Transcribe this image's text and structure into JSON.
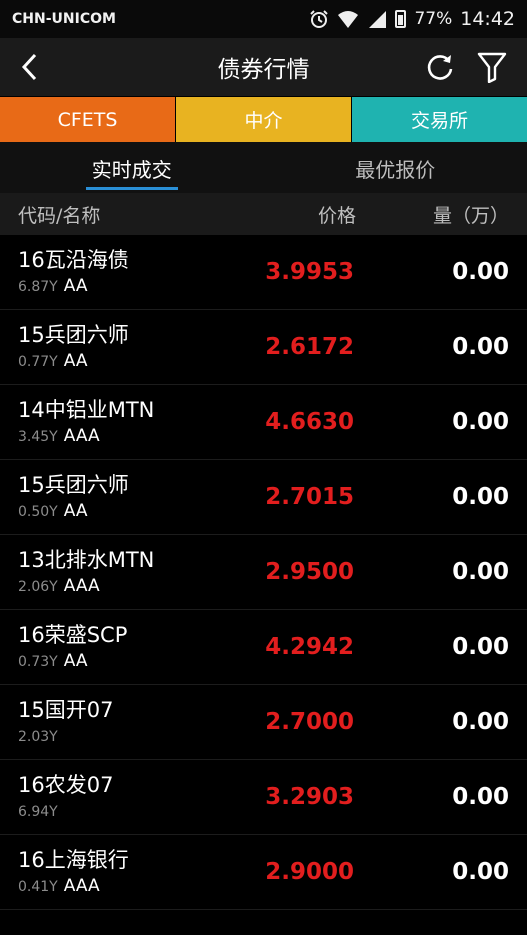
{
  "status_bar": {
    "carrier": "CHN-UNICOM",
    "battery": "77%",
    "time": "14:42",
    "icons": [
      "alarm-icon",
      "wifi-icon",
      "signal-icon",
      "battery-icon"
    ]
  },
  "app_bar": {
    "title": "债券行情",
    "back_icon": "back-chevron-icon",
    "refresh_icon": "refresh-icon",
    "filter_icon": "filter-icon"
  },
  "market_tabs": [
    {
      "label": "CFETS",
      "color": "#e86a17"
    },
    {
      "label": "中介",
      "color": "#e8b321"
    },
    {
      "label": "交易所",
      "color": "#1fb3b0"
    }
  ],
  "sub_tabs": {
    "active": "实时成交",
    "inactive": "最优报价",
    "accent": "#2a8fd6"
  },
  "columns": {
    "name": "代码/名称",
    "price": "价格",
    "volume": "量（万）"
  },
  "rows": [
    {
      "name": "16瓦沿海债",
      "term": "6.87Y",
      "rating": "AA",
      "price": "3.9953",
      "volume": "0.00"
    },
    {
      "name": "15兵团六师",
      "term": "0.77Y",
      "rating": "AA",
      "price": "2.6172",
      "volume": "0.00"
    },
    {
      "name": "14中铝业MTN",
      "term": "3.45Y",
      "rating": "AAA",
      "price": "4.6630",
      "volume": "0.00"
    },
    {
      "name": "15兵团六师",
      "term": "0.50Y",
      "rating": "AA",
      "price": "2.7015",
      "volume": "0.00"
    },
    {
      "name": "13北排水MTN",
      "term": "2.06Y",
      "rating": "AAA",
      "price": "2.9500",
      "volume": "0.00"
    },
    {
      "name": "16荣盛SCP",
      "term": "0.73Y",
      "rating": "AA",
      "price": "4.2942",
      "volume": "0.00"
    },
    {
      "name": "15国开07",
      "term": "2.03Y",
      "rating": "",
      "price": "2.7000",
      "volume": "0.00"
    },
    {
      "name": "16农发07",
      "term": "6.94Y",
      "rating": "",
      "price": "3.2903",
      "volume": "0.00"
    },
    {
      "name": "16上海银行",
      "term": "0.41Y",
      "rating": "AAA",
      "price": "2.9000",
      "volume": "0.00"
    }
  ],
  "colors": {
    "price_red": "#e21e1e",
    "background": "#000000"
  }
}
